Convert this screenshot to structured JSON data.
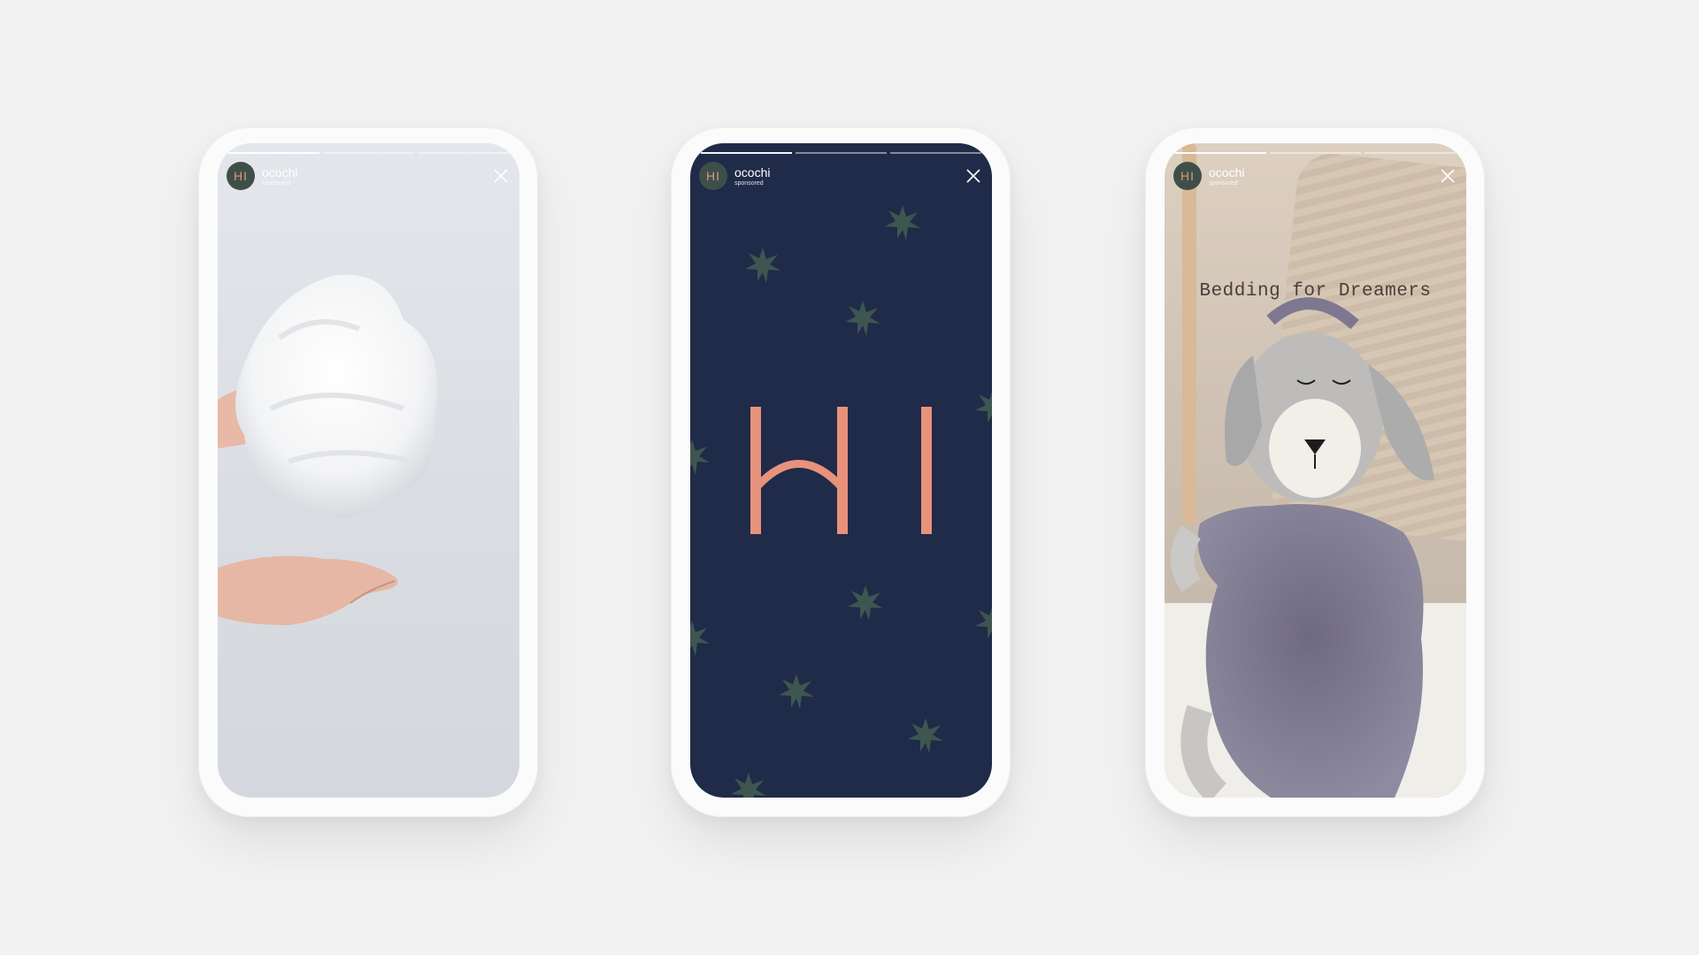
{
  "stories": [
    {
      "account": "ocochi",
      "sponsored": "sponsored",
      "avatar_text": "HI",
      "progress": [
        1,
        0,
        0
      ],
      "scene": "hands holding white fluffy fiber filling against light grey background"
    },
    {
      "account": "ocochi",
      "sponsored": "sponsored",
      "avatar_text": "HI",
      "progress": [
        1,
        0,
        0
      ],
      "logo_text": "HI",
      "background_color": "#1f2b48",
      "logo_color": "#e8927b",
      "star_color": "#3e5650"
    },
    {
      "account": "ocochi",
      "sponsored": "sponsored",
      "avatar_text": "HI",
      "progress": [
        1,
        0,
        0
      ],
      "headline": "Bedding for Dreamers",
      "scene": "grey plush dog toy with fluffy purple-grey fur resting against a pillow"
    }
  ],
  "icons": {
    "close": "close-icon"
  }
}
